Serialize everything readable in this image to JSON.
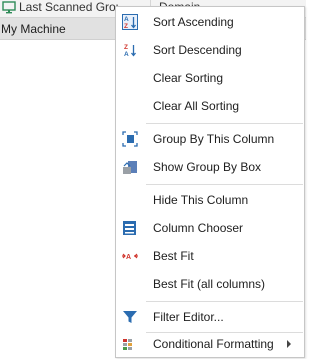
{
  "grid": {
    "columns": [
      {
        "label": "Last Scanned Group",
        "icon": "monitor-icon"
      },
      {
        "label": "Domain"
      }
    ],
    "rows": [
      {
        "label": "My Machine"
      }
    ]
  },
  "menu": {
    "items": [
      {
        "label": "Sort Ascending",
        "icon": "sort-ascending-icon"
      },
      {
        "label": "Sort Descending",
        "icon": "sort-descending-icon"
      },
      {
        "label": "Clear Sorting",
        "icon": ""
      },
      {
        "label": "Clear All Sorting",
        "icon": ""
      },
      {
        "label": "Group By This Column",
        "icon": "group-by-column-icon"
      },
      {
        "label": "Show Group By Box",
        "icon": "group-by-box-icon"
      },
      {
        "label": "Hide This Column",
        "icon": ""
      },
      {
        "label": "Column Chooser",
        "icon": "column-chooser-icon"
      },
      {
        "label": "Best Fit",
        "icon": "best-fit-icon"
      },
      {
        "label": "Best Fit (all columns)",
        "icon": ""
      },
      {
        "label": "Filter Editor...",
        "icon": "filter-icon"
      },
      {
        "label": "Conditional Formatting",
        "icon": "conditional-formatting-icon",
        "submenu": true
      }
    ]
  },
  "colors": {
    "accent_blue": "#2b6cb0",
    "icon_red": "#d0342c",
    "row_selected": "#e1e1e1"
  }
}
